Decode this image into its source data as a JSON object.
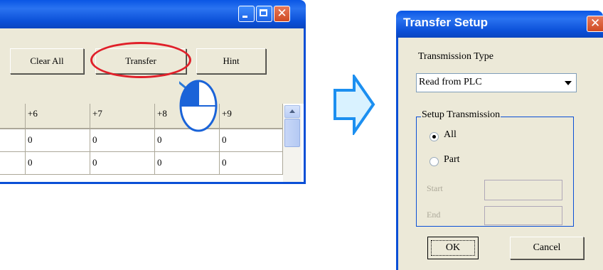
{
  "main_window": {
    "toolbar": {
      "clear_all_label": "Clear All",
      "transfer_label": "Transfer",
      "hint_label": "Hint"
    },
    "table": {
      "columns": [
        "+6",
        "+7",
        "+8",
        "+9"
      ],
      "rows": [
        [
          "0",
          "0",
          "0",
          "0"
        ],
        [
          "0",
          "0",
          "0",
          "0"
        ]
      ]
    }
  },
  "dialog": {
    "title": "Transfer Setup",
    "transmission_type_label": "Transmission Type",
    "transmission_type_value": "Read from PLC",
    "setup_group_label": "Setup Transmission",
    "option_all": "All",
    "option_part": "Part",
    "start_label": "Start",
    "end_label": "End",
    "ok_label": "OK",
    "cancel_label": "Cancel"
  },
  "colors": {
    "titlebar_blue": "#0a56e4",
    "highlight_red": "#e0202a",
    "arrow_blue": "#1c8ff0",
    "window_face": "#ece9d8"
  },
  "icons": [
    "minimize-icon",
    "maximize-icon",
    "close-icon",
    "mouse-click-icon",
    "right-arrow-icon",
    "dropdown-caret-icon"
  ]
}
